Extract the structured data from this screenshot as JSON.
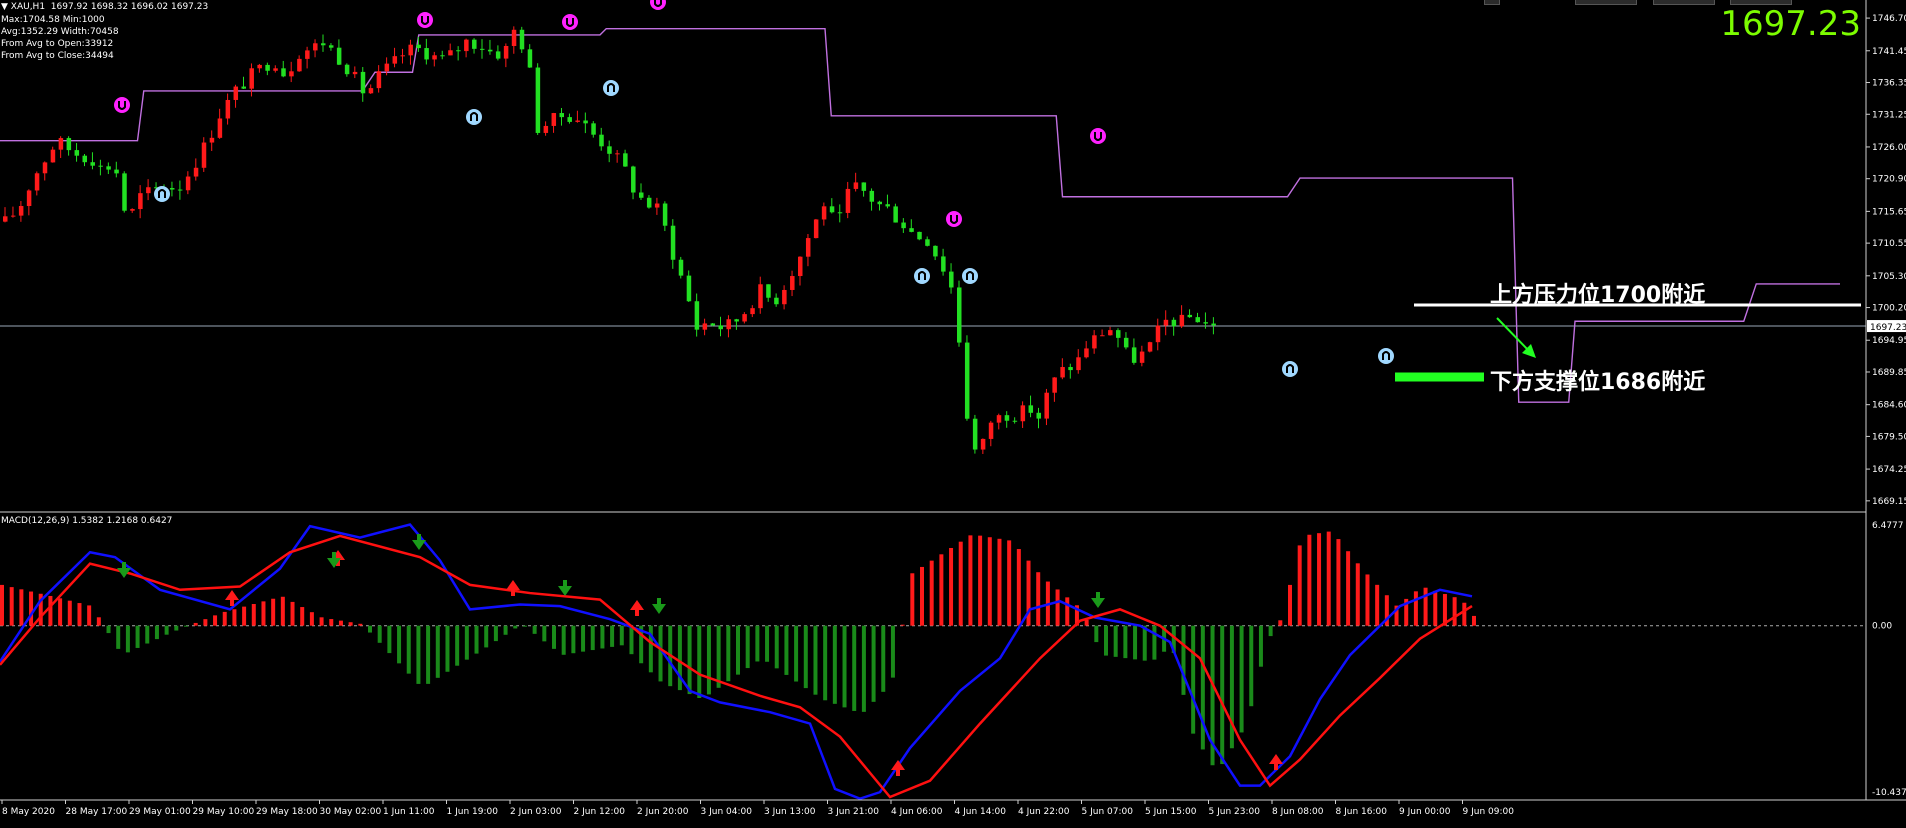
{
  "header": {
    "symbol_line": "▼ XAU,H1  1697.92 1698.32 1696.02 1697.23",
    "indicator_lines": [
      "Max:1704.58 Min:1000",
      "Avg:1352.29 Width:70458",
      "From Avg to Open:33912",
      "From Avg to Close:34494"
    ],
    "current_price_big": "1697.23",
    "price_tag": "1697.23"
  },
  "price_axis": {
    "labels": [
      "1746.70",
      "1741.45",
      "1736.35",
      "1731.25",
      "1726.00",
      "1720.90",
      "1715.65",
      "1710.55",
      "1705.30",
      "1700.20",
      "1694.95",
      "1689.85",
      "1684.60",
      "1679.50",
      "1674.25",
      "1669.15"
    ]
  },
  "macd": {
    "label": "MACD(12,26,9) 1.5382 1.2168 0.6427",
    "axis_labels": [
      "6.4777",
      "0.00",
      "-10.4372"
    ]
  },
  "time_axis": {
    "labels": [
      "8 May 2020",
      "28 May 17:00",
      "29 May 01:00",
      "29 May 10:00",
      "29 May 18:00",
      "30 May 02:00",
      "1 Jun 11:00",
      "1 Jun 19:00",
      "2 Jun 03:00",
      "2 Jun 12:00",
      "2 Jun 20:00",
      "3 Jun 04:00",
      "3 Jun 13:00",
      "3 Jun 21:00",
      "4 Jun 06:00",
      "4 Jun 14:00",
      "4 Jun 22:00",
      "5 Jun 07:00",
      "5 Jun 15:00",
      "5 Jun 23:00",
      "8 Jun 08:00",
      "8 Jun 16:00",
      "9 Jun 00:00",
      "9 Jun 09:00"
    ]
  },
  "annotations": {
    "resistance": "上方压力位1700附近",
    "support": "下方支撑位1686附近"
  },
  "colors": {
    "bull": "#ff1a1a",
    "bear": "#22e022",
    "envelope": "#c070e0",
    "macd_line": "#1010ff",
    "signal_line": "#ff1010",
    "hist_up": "#ff1a1a",
    "hist_down": "#1a8a1a",
    "price_line": "#9aa8b8",
    "big_price": "#7cfc00",
    "fractal_up": "#ff22ff",
    "fractal_down": "#a0d8ff",
    "support_bar": "#22ff22"
  },
  "chart_data": [
    {
      "type": "candlestick",
      "title": "XAU,H1",
      "ylim": [
        1668,
        1748
      ],
      "current_price": 1697.23,
      "ohlc": [
        1697.92,
        1698.32,
        1696.02,
        1697.23
      ],
      "close_path": [
        [
          0,
          1714
        ],
        [
          10,
          1716
        ],
        [
          25,
          1722
        ],
        [
          40,
          1727
        ],
        [
          55,
          1725
        ],
        [
          68,
          1724
        ],
        [
          78,
          1722
        ],
        [
          85,
          1724
        ],
        [
          95,
          1714
        ],
        [
          105,
          1718
        ],
        [
          115,
          1719
        ],
        [
          125,
          1720
        ],
        [
          135,
          1719
        ],
        [
          150,
          1724
        ],
        [
          160,
          1728
        ],
        [
          170,
          1732
        ],
        [
          180,
          1735
        ],
        [
          195,
          1738
        ],
        [
          210,
          1740
        ],
        [
          220,
          1737
        ],
        [
          228,
          1741
        ],
        [
          240,
          1742
        ],
        [
          250,
          1743
        ],
        [
          262,
          1740
        ],
        [
          270,
          1738
        ],
        [
          282,
          1734
        ],
        [
          290,
          1737
        ],
        [
          300,
          1739
        ],
        [
          312,
          1741
        ],
        [
          320,
          1742
        ],
        [
          330,
          1741
        ],
        [
          340,
          1740
        ],
        [
          350,
          1741
        ],
        [
          360,
          1743
        ],
        [
          375,
          1742
        ],
        [
          382,
          1741
        ],
        [
          390,
          1741
        ],
        [
          395,
          1745
        ],
        [
          402,
          1744
        ],
        [
          410,
          1738
        ],
        [
          415,
          1729
        ],
        [
          425,
          1730
        ],
        [
          435,
          1731
        ],
        [
          445,
          1731
        ],
        [
          455,
          1729
        ],
        [
          465,
          1727
        ],
        [
          475,
          1725
        ],
        [
          485,
          1722
        ],
        [
          492,
          1719
        ],
        [
          500,
          1717
        ],
        [
          510,
          1716
        ],
        [
          520,
          1710
        ],
        [
          530,
          1704
        ],
        [
          540,
          1697
        ],
        [
          550,
          1698
        ],
        [
          560,
          1697
        ],
        [
          570,
          1698
        ],
        [
          580,
          1700
        ],
        [
          590,
          1703
        ],
        [
          600,
          1701
        ],
        [
          610,
          1704
        ],
        [
          620,
          1708
        ],
        [
          630,
          1713
        ],
        [
          640,
          1717
        ],
        [
          650,
          1713
        ],
        [
          660,
          1720
        ],
        [
          670,
          1719
        ],
        [
          680,
          1717
        ],
        [
          690,
          1716
        ],
        [
          700,
          1714
        ],
        [
          710,
          1712
        ],
        [
          720,
          1711
        ],
        [
          730,
          1708
        ],
        [
          740,
          1703
        ],
        [
          745,
          1695
        ],
        [
          752,
          1681
        ],
        [
          760,
          1676
        ],
        [
          770,
          1682
        ],
        [
          780,
          1683
        ],
        [
          790,
          1683
        ],
        [
          800,
          1684
        ],
        [
          810,
          1682
        ],
        [
          815,
          1687
        ],
        [
          825,
          1690
        ],
        [
          835,
          1691
        ],
        [
          845,
          1694
        ],
        [
          855,
          1696
        ],
        [
          865,
          1697
        ],
        [
          875,
          1693
        ],
        [
          882,
          1692
        ],
        [
          890,
          1693
        ],
        [
          898,
          1695
        ],
        [
          905,
          1698
        ],
        [
          912,
          1698
        ],
        [
          920,
          1698
        ],
        [
          928,
          1699
        ],
        [
          936,
          1698
        ],
        [
          944,
          1697
        ]
      ]
    },
    {
      "type": "line",
      "title": "MACD(12,26,9)",
      "ylim": [
        -10.4372,
        6.4777
      ],
      "values": {
        "macd": 1.5382,
        "signal": 1.2168,
        "histogram": 0.6427
      }
    }
  ]
}
